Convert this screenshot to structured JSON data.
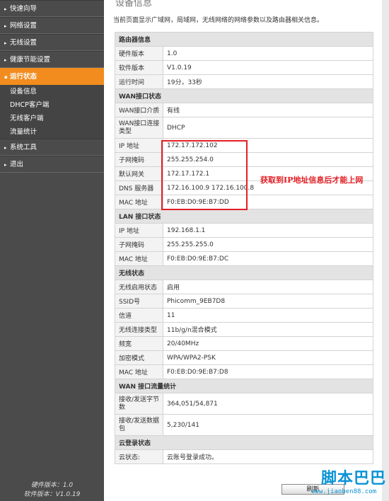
{
  "sidebar": {
    "items": [
      {
        "label": "快速向导"
      },
      {
        "label": "网络设置"
      },
      {
        "label": "无线设置"
      },
      {
        "label": "健康节能设置"
      },
      {
        "label": "运行状态"
      },
      {
        "label": "系统工具"
      },
      {
        "label": "退出"
      }
    ],
    "sub_items": [
      {
        "label": "设备信息"
      },
      {
        "label": "DHCP客户端"
      },
      {
        "label": "无线客户端"
      },
      {
        "label": "流量统计"
      }
    ],
    "footer": {
      "hw": "硬件版本：1.0",
      "sw": "软件版本：V1.0.19"
    }
  },
  "main": {
    "title": "设备信息",
    "description": "当前页面显示广域网，局域网，无线网络的网络参数以及路由器相关信息。",
    "refresh_button": "刷新"
  },
  "router_info": {
    "header": "路由器信息",
    "rows": [
      {
        "label": "硬件版本",
        "value": "1.0"
      },
      {
        "label": "软件版本",
        "value": "V1.0.19"
      },
      {
        "label": "运行时间",
        "value": "19分，33秒"
      }
    ]
  },
  "wan": {
    "header": "WAN接口状态",
    "rows": [
      {
        "label": "WAN接口介质",
        "value": "有线"
      },
      {
        "label": "WAN接口连接类型",
        "value": "DHCP"
      },
      {
        "label": "IP 地址",
        "value": "172.17.172.102"
      },
      {
        "label": "子网掩码",
        "value": "255.255.254.0"
      },
      {
        "label": "默认网关",
        "value": "172.17.172.1"
      },
      {
        "label": "DNS 服务器",
        "value": "172.16.100.9 172.16.100.8"
      },
      {
        "label": "MAC 地址",
        "value": "F0:EB:D0:9E:B7:DD"
      }
    ]
  },
  "lan": {
    "header": "LAN 接口状态",
    "rows": [
      {
        "label": "IP 地址",
        "value": "192.168.1.1"
      },
      {
        "label": "子网掩码",
        "value": "255.255.255.0"
      },
      {
        "label": "MAC 地址",
        "value": "F0:EB:D0:9E:B7:DC"
      }
    ]
  },
  "wireless": {
    "header": "无线状态",
    "rows": [
      {
        "label": "无线启用状态",
        "value": "启用"
      },
      {
        "label": "SSID号",
        "value": "Phicomm_9EB7D8"
      },
      {
        "label": "信道",
        "value": "11"
      },
      {
        "label": "无线连接类型",
        "value": "11b/g/n混合模式"
      },
      {
        "label": "频宽",
        "value": "20/40MHz"
      },
      {
        "label": "加密模式",
        "value": "WPA/WPA2-PSK"
      },
      {
        "label": "MAC 地址",
        "value": "F0:EB:D0:9E:B7:D8"
      }
    ]
  },
  "traffic": {
    "header": "WAN 接口流量统计",
    "rows": [
      {
        "label": "接收/发送字节数",
        "value": "364,051/54,871"
      },
      {
        "label": "接收/发送数据包",
        "value": "5,230/141"
      }
    ]
  },
  "cloud": {
    "header": "云登录状态",
    "rows": [
      {
        "label": "云状态:",
        "value": "云账号登录成功。"
      }
    ]
  },
  "annotation": {
    "text": "获取到IP地址信息后才能上网",
    "color": "#e41f25"
  },
  "watermark": {
    "logo": "脚本巴巴",
    "url": "www.jiaoben88.com"
  },
  "colors": {
    "sidebar_bg": "#4b4b4b",
    "active_item": "#f28c1f",
    "section_bg": "#e3e3e3",
    "watermark": "#0a93d6"
  }
}
